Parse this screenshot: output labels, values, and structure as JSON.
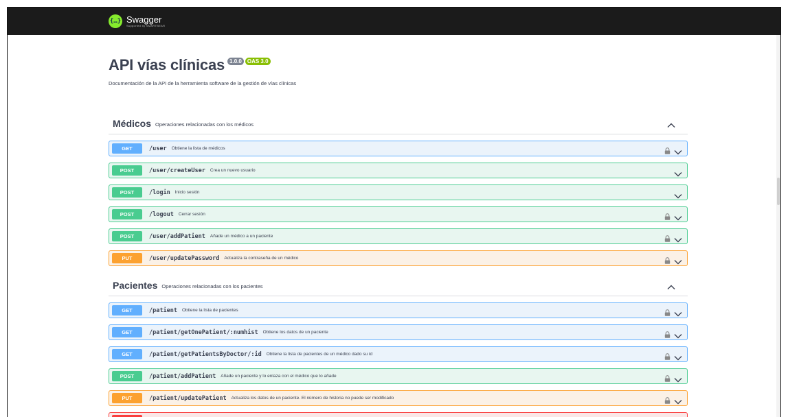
{
  "topbar": {
    "logo_name": "Swagger",
    "logo_sub": "Supported by SMARTBEAR"
  },
  "info": {
    "title": "API vías clínicas",
    "version_badge": "1.0.0",
    "oas_badge": "OAS 3.0",
    "description": "Documentación de la API de la herramienta software de la gestión de vías clínicas"
  },
  "tags": [
    {
      "name": "Médicos",
      "description": "Operaciones relacionadas con los médicos",
      "operations": [
        {
          "method": "GET",
          "path": "/user",
          "summary": "Obtiene la lista de médicos",
          "locked": true
        },
        {
          "method": "POST",
          "path": "/user/createUser",
          "summary": "Crea un nuevo usuario",
          "locked": false
        },
        {
          "method": "POST",
          "path": "/login",
          "summary": "Inicio sesión",
          "locked": false
        },
        {
          "method": "POST",
          "path": "/logout",
          "summary": "Cerrar sesión",
          "locked": true
        },
        {
          "method": "POST",
          "path": "/user/addPatient",
          "summary": "Añade un médico a un paciente",
          "locked": true
        },
        {
          "method": "PUT",
          "path": "/user/updatePassword",
          "summary": "Actualiza la contraseña de un médico",
          "locked": true
        }
      ]
    },
    {
      "name": "Pacientes",
      "description": "Operaciones relacionadas con los pacientes",
      "operations": [
        {
          "method": "GET",
          "path": "/patient",
          "summary": "Obtiene la lista de pacientes",
          "locked": true
        },
        {
          "method": "GET",
          "path": "/patient/getOnePatient/:numhist",
          "summary": "Obtiene los datos de un paciente",
          "locked": true
        },
        {
          "method": "GET",
          "path": "/patient/getPatientsByDoctor/:id",
          "summary": "Obtiene la lista de pacientes de un médico dado su id",
          "locked": true
        },
        {
          "method": "POST",
          "path": "/patient/addPatient",
          "summary": "Añade un paciente y lo enlaza con el médico que lo añade",
          "locked": true
        },
        {
          "method": "PUT",
          "path": "/patient/updatePatient",
          "summary": "Actualiza los datos de un paciente. El número de historia no puede ser modificado",
          "locked": true
        },
        {
          "method": "",
          "path": "",
          "summary": "",
          "locked": true
        }
      ]
    }
  ],
  "colors": {
    "get": "#61affe",
    "post": "#49cc90",
    "put": "#fca130",
    "delete": "#f93e3e",
    "topbar": "#1b1b1b",
    "logo": "#85ea2d"
  }
}
